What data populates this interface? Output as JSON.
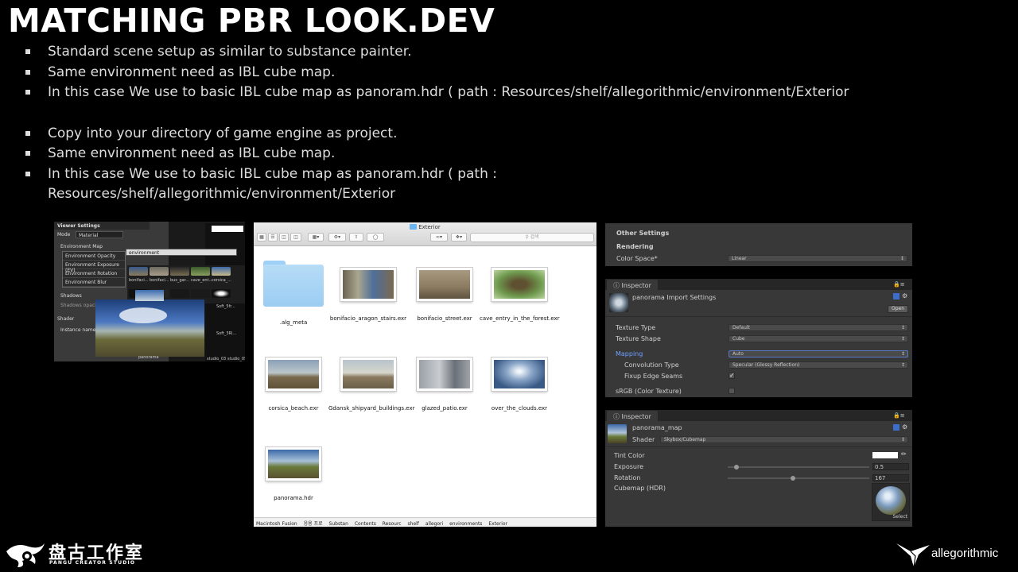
{
  "title": "MATCHING PBR LOOK.DEV",
  "bullets_group1": [
    "Standard scene setup as similar to substance painter.",
    "Same environment  need as IBL cube map.",
    "In this case We use to basic IBL cube map as panoram.hdr ( path : Resources/shelf/allegorithmic/environment/Exterior"
  ],
  "bullets_group2": [
    "Copy into your directory of game engine as project.",
    "Same environment  need as IBL cube map.",
    "In this case We use to basic IBL cube map as panoram.hdr ( path :"
  ],
  "bullet_wrap_continuation": "Resources/shelf/allegorithmic/environment/Exterior",
  "viewer_settings": {
    "header": "Viewer Settings",
    "mode_label": "Mode",
    "mode_value": "Material",
    "env_map_label": "Environment Map",
    "search_value": "environment",
    "dropdown_items": [
      "Environment Opacity",
      "Environment Exposure (EV)",
      "Environment Rotation",
      "Environment Blur"
    ],
    "shadows_label": "Shadows",
    "shadows_opacity_label": "Shadows opacity",
    "shader_label": "Shader",
    "instance_name_label": "Instance name",
    "thumb_labels": [
      "bonifaci...",
      "bonifaci...",
      "bus_gar...",
      "cave_ent...",
      "corsica_..."
    ],
    "preview_label": "panorama",
    "right_labels": [
      "Soft_5fr...",
      "Soft_3Rl...",
      "studio_03",
      "studio_05"
    ]
  },
  "finder": {
    "window_title": "Exterior",
    "search_placeholder": "검색",
    "items": [
      {
        "name": ".alg_meta",
        "kind": "folder"
      },
      {
        "name": "bonifacio_aragon_stairs.exr",
        "kind": "image"
      },
      {
        "name": "bonifacio_street.exr",
        "kind": "image"
      },
      {
        "name": "cave_entry_in_the_forest.exr",
        "kind": "image"
      },
      {
        "name": "corsica_beach.exr",
        "kind": "image"
      },
      {
        "name": "Gdansk_shipyard_buildings.exr",
        "kind": "image"
      },
      {
        "name": "glazed_patio.exr",
        "kind": "image"
      },
      {
        "name": "over_the_clouds.exr",
        "kind": "image"
      },
      {
        "name": "panorama.hdr",
        "kind": "image"
      }
    ],
    "path": [
      "Macintosh Fusion",
      "응용 프로",
      "Substan",
      "Contents",
      "Resourc",
      "shelf",
      "allegori",
      "environments",
      "Exterior"
    ]
  },
  "other_settings": {
    "section": "Other Settings",
    "rendering": "Rendering",
    "color_space_label": "Color Space*",
    "color_space_value": "Linear"
  },
  "import_inspector": {
    "tab": "Inspector",
    "asset_title": "panorama Import Settings",
    "open_button": "Open",
    "texture_type_label": "Texture Type",
    "texture_type_value": "Default",
    "texture_shape_label": "Texture Shape",
    "texture_shape_value": "Cube",
    "mapping_label": "Mapping",
    "mapping_value": "Auto",
    "convolution_label": "Convolution Type",
    "convolution_value": "Specular (Glossy Reflection)",
    "fixup_label": "Fixup Edge Seams",
    "fixup_checked": true,
    "srgb_label": "sRGB (Color Texture)",
    "srgb_checked": false,
    "accent_color": "#6fa0ff"
  },
  "material_inspector": {
    "tab": "Inspector",
    "material_name": "panorama_map",
    "shader_label": "Shader",
    "shader_value": "Skybox/Cubemap",
    "tint_label": "Tint Color",
    "exposure_label": "Exposure",
    "exposure_value": "0.5",
    "rotation_label": "Rotation",
    "rotation_value": "167",
    "exposure_fraction": 0.06,
    "rotation_fraction": 0.46,
    "cubemap_label": "Cubemap   (HDR)",
    "select_button": "Select"
  },
  "logo_left": {
    "cn": "盘古工作室",
    "en": "PANGU CREATOR STUDIO"
  },
  "logo_right": {
    "word": "allegorithmic"
  }
}
